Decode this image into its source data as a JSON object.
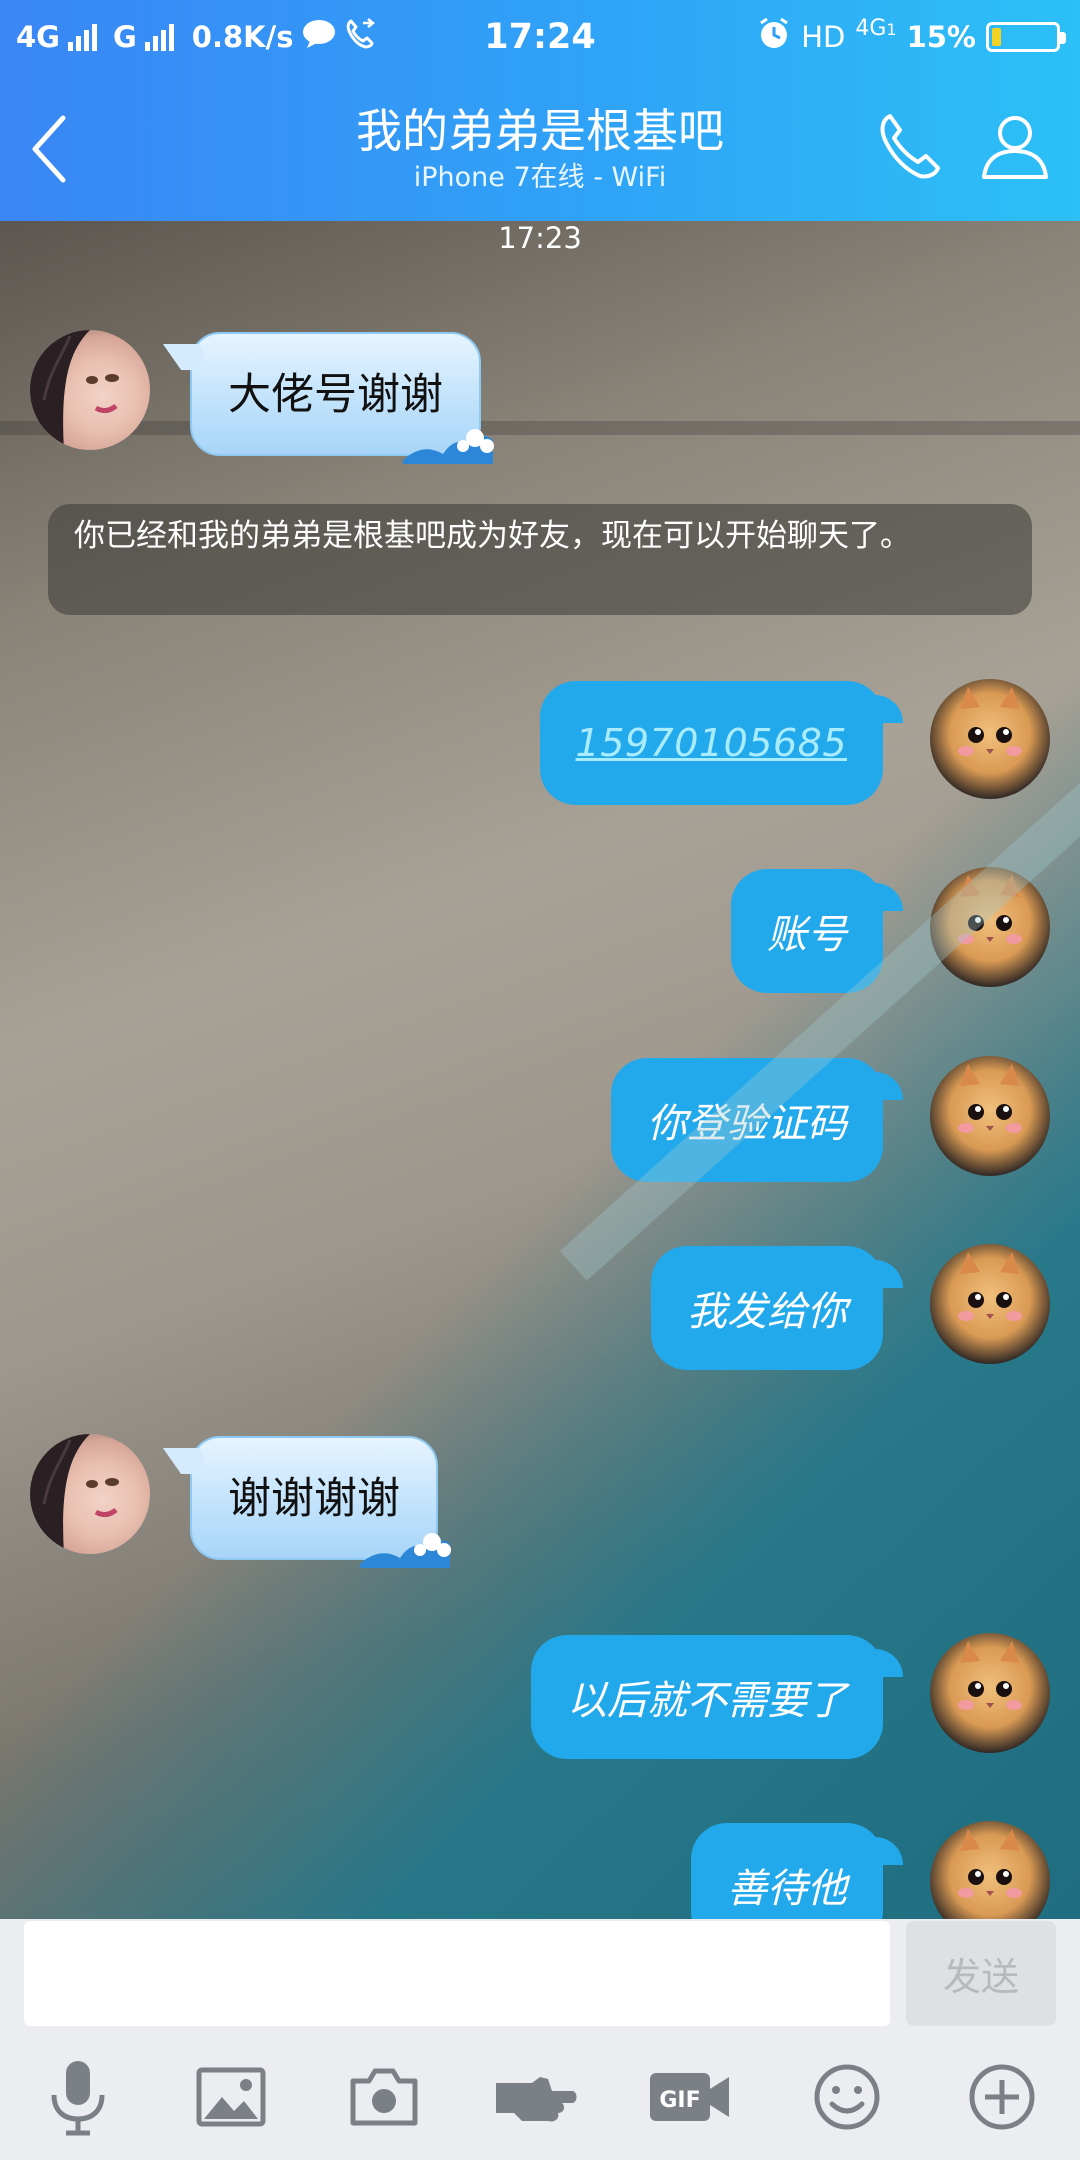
{
  "status_bar": {
    "network_left": "4G",
    "network_mid": "G",
    "speed": "0.8K/s",
    "time": "17:24",
    "hd": "HD",
    "network_right": "4G",
    "sim_index": "1",
    "battery_percent": "15%",
    "battery_level": 0.15,
    "battery_color": "#f4d224"
  },
  "header": {
    "title": "我的弟弟是根基吧",
    "subtitle": "iPhone 7在线 - WiFi",
    "back_icon": "chevron-left-icon",
    "call_icon": "phone-icon",
    "profile_icon": "person-icon",
    "gradient_start": "#3a86f5",
    "gradient_end": "#2cc0f6"
  },
  "chat": {
    "timestamp": "17:23",
    "system_message": "你已经和我的弟弟是根基吧成为好友，现在可以开始聊天了。",
    "messages": [
      {
        "sender": "friend",
        "text": "大佬号谢谢"
      },
      {
        "sender": "me",
        "text": "15970105685",
        "type": "phone-link"
      },
      {
        "sender": "me",
        "text": "账号"
      },
      {
        "sender": "me",
        "text": "你登验证码"
      },
      {
        "sender": "me",
        "text": "我发给你"
      },
      {
        "sender": "friend",
        "text": "谢谢谢谢"
      },
      {
        "sender": "me",
        "text": "以后就不需要了"
      },
      {
        "sender": "me",
        "text": "善待他"
      }
    ],
    "my_bubble_color": "#22a9ec",
    "friend_bubble_color": "#bfe1fb"
  },
  "input": {
    "value": "",
    "placeholder": "",
    "send_label": "发送"
  },
  "toolbar": {
    "items": [
      "microphone-icon",
      "image-icon",
      "camera-icon",
      "poke-hand-icon",
      "gif-icon",
      "emoji-icon",
      "plus-icon"
    ],
    "gif_label": "GIF"
  }
}
